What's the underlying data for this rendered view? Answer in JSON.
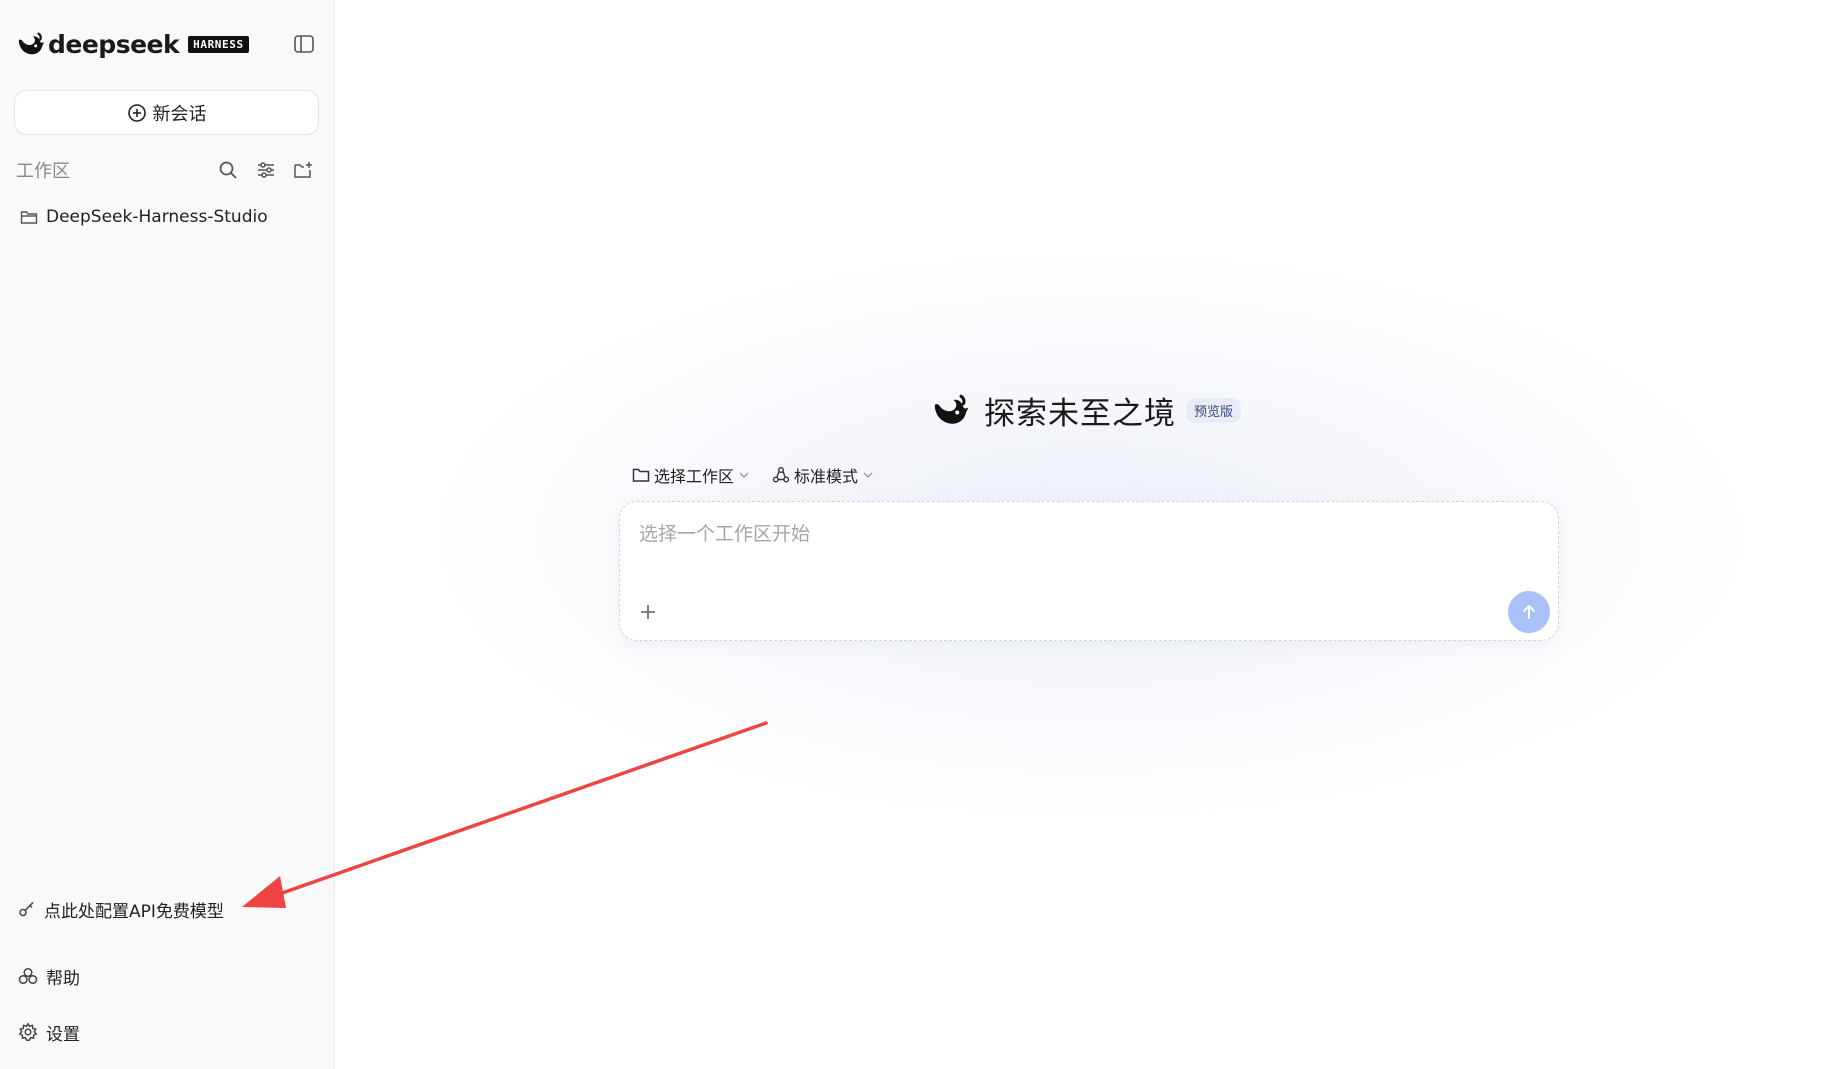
{
  "sidebar": {
    "brand": {
      "name": "deepseek",
      "badge": "HARNESS",
      "icon": "whale-logo-icon"
    },
    "new_chat_label": "新会话",
    "workspace": {
      "title": "工作区",
      "tools": [
        "search-icon",
        "filter-icon",
        "new-folder-icon"
      ],
      "items": [
        {
          "label": "DeepSeek-Harness-Studio",
          "icon": "folder-icon"
        }
      ]
    },
    "bottom_links": [
      {
        "label": "点此处配置API免费模型",
        "icon": "key-icon"
      },
      {
        "label": "帮助",
        "icon": "help-icon"
      },
      {
        "label": "设置",
        "icon": "gear-icon"
      }
    ]
  },
  "main": {
    "hero_title": "探索未至之境",
    "hero_badge": "预览版",
    "chips": [
      {
        "label": "选择工作区",
        "icon": "folder-icon"
      },
      {
        "label": "标准模式",
        "icon": "mode-icon"
      }
    ],
    "composer": {
      "placeholder": "选择一个工作区开始",
      "value": ""
    }
  },
  "colors": {
    "accent": "#a9c1f7",
    "annotation_arrow": "#ef4444",
    "sidebar_bg": "#f9f9fa"
  }
}
